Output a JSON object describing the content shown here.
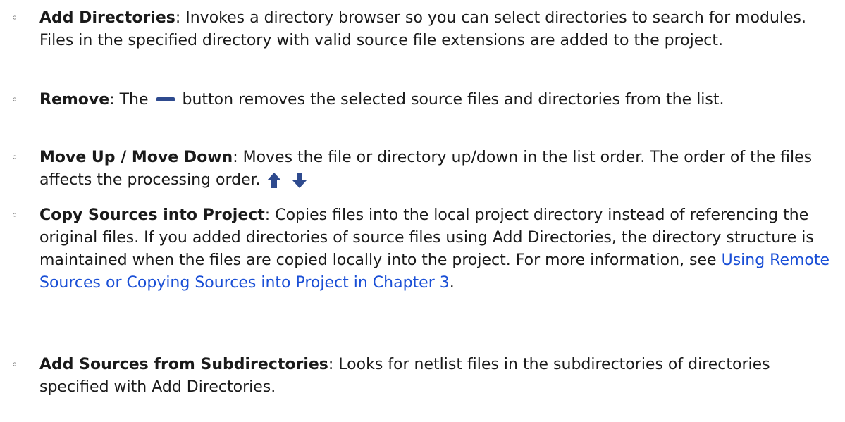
{
  "bullet_char": "◦",
  "items": [
    {
      "term": "Add Directories",
      "sep": ": ",
      "text": "Invokes a directory browser so you can select directories to search for modules. Files in the specified directory with valid source file extensions are added to the project."
    },
    {
      "term": "Remove",
      "sep": ": ",
      "text_before": "The",
      "icon": "minus-bar-icon",
      "text_after": "button removes the selected source files and directories from the list."
    },
    {
      "term": "Move Up / Move Down",
      "sep": ": ",
      "text": "Moves the file or directory up/down in the list order. The order of the files affects the processing order.",
      "icons": [
        "up-arrow-icon",
        "down-arrow-icon"
      ]
    },
    {
      "term": "Copy Sources into Project",
      "sep": ": ",
      "text": "Copies files into the local project directory instead of referencing the original files. If you added directories of source files using Add Directories, the directory structure is maintained when the files are copied locally into the project. For more information, see",
      "link": "Using Remote Sources or Copying Sources into Project in Chapter 3",
      "text_end": "."
    },
    {
      "term": "Add Sources from Subdirectories",
      "sep": ": ",
      "text": "Looks for netlist files in the subdirectories of directories specified with Add Directories."
    }
  ],
  "colors": {
    "link": "#1a4fd6",
    "icon": "#2e4a8e"
  }
}
